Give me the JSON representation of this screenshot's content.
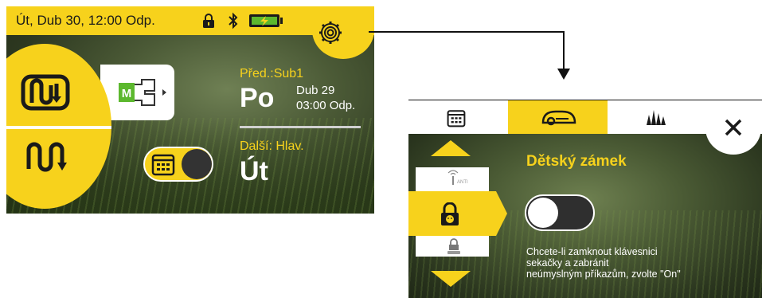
{
  "left_screen": {
    "status": {
      "datetime": "Út, Dub 30, 12:00 Odp.",
      "icons": [
        "lock-icon",
        "bluetooth-icon",
        "battery-charging-icon"
      ],
      "settings_icon": "gear-icon"
    },
    "mode_icons": [
      "loop-mode-icon",
      "zigzag-mode-icon",
      "map-zones-icon"
    ],
    "map_badge": "M",
    "previous": {
      "label": "Před.:Sub1",
      "day": "Po",
      "date": "Dub 29",
      "time": "03:00 Odp."
    },
    "next": {
      "label": "Další: Hlav.",
      "day": "Út"
    },
    "schedule_toggle_icon": "calendar-icon"
  },
  "right_screen": {
    "tabs": [
      {
        "icon": "calendar-icon",
        "active": false
      },
      {
        "icon": "mower-icon",
        "active": true
      },
      {
        "icon": "grass-icon",
        "active": false
      }
    ],
    "close_icon": "close-icon",
    "list_items": [
      {
        "icon": "gps-antenna-icon",
        "label": "ANTI"
      },
      {
        "icon": "child-lock-icon",
        "label": "",
        "selected": true
      },
      {
        "icon": "keypad-lock-icon",
        "label": ""
      }
    ],
    "title": "Dětský zámek",
    "toggle_state": "off",
    "description": [
      "Chcete-li zamknout klávesnici",
      "sekačky a zabránit",
      "neúmyslným příkazům, zvolte \"On\""
    ]
  },
  "colors": {
    "accent": "#f7d21c",
    "dark": "#1a1a1a",
    "green": "#5cb82e"
  }
}
